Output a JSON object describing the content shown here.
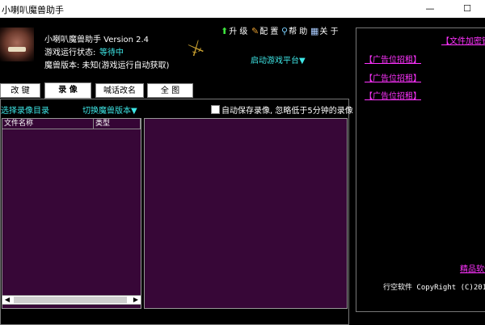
{
  "window": {
    "title": "小喇叭魔兽助手",
    "minimize": "—",
    "maximize": "☐"
  },
  "header": {
    "app_name": "小喇叭魔兽助手 Version 2.4",
    "status_label": "游戏运行状态:",
    "status_value": "等待中",
    "version_info": "魔兽版本: 未知(游戏运行自动获取)",
    "platform_link": "启动游戏平台▼"
  },
  "topnav": {
    "upgrade": "升 级",
    "config": "配 置",
    "help": "帮 助",
    "about": "关 于"
  },
  "tabs": [
    {
      "label": "改 键"
    },
    {
      "label": "录 像"
    },
    {
      "label": "喊话改名"
    },
    {
      "label": "全 图"
    }
  ],
  "replay": {
    "select_dir": "选择录像目录",
    "switch_version": "切换魔兽版本▼",
    "autosave": "自动保存录像, 忽略低于5分钟的录像",
    "col_filename": "文件名称",
    "col_type": "类型"
  },
  "right_panel": {
    "encrypt_link": "【文件加密锁",
    "ads": [
      "【广告位招租】",
      "【广告位招租】",
      "【广告位招租】"
    ],
    "quality_link": "精品软件",
    "copyright": "行空软件 CopyRight (C)201"
  },
  "colors": {
    "accent_cyan": "#3ee6e6",
    "link_magenta": "#ff33ff",
    "panel_purple": "#370737"
  }
}
